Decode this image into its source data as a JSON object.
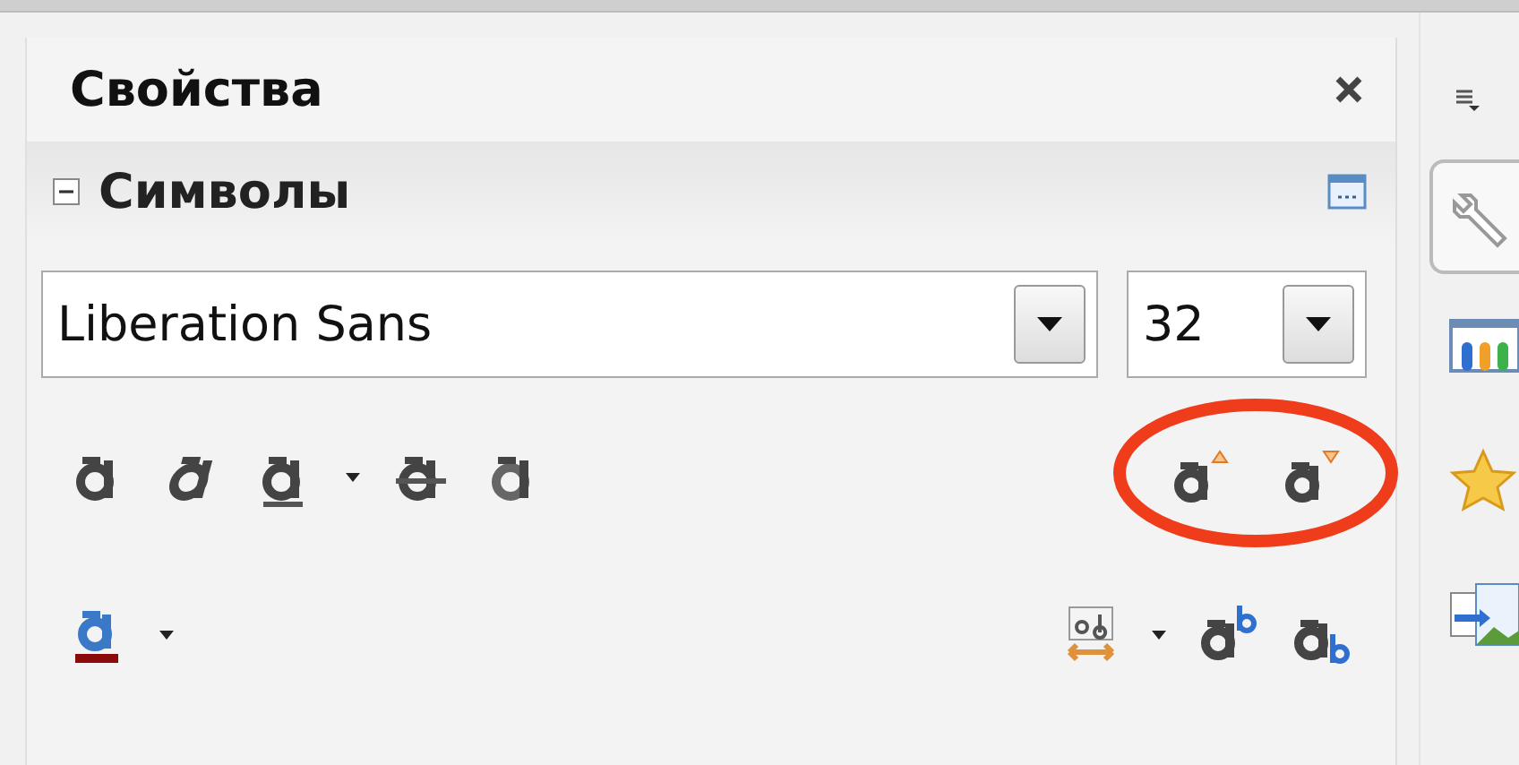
{
  "panel": {
    "title": "Свойства"
  },
  "section": {
    "title": "Символы",
    "expanded": true
  },
  "font_name": {
    "value": "Liberation Sans"
  },
  "font_size": {
    "value": "32"
  },
  "format_row": [
    {
      "kind": "bold",
      "dropdown": false
    },
    {
      "kind": "italic",
      "dropdown": false
    },
    {
      "kind": "underline",
      "dropdown": true
    },
    {
      "kind": "strike",
      "dropdown": false
    },
    {
      "kind": "shadow",
      "dropdown": false
    }
  ],
  "size_row": [
    {
      "kind": "grow",
      "dropdown": false
    },
    {
      "kind": "shrink",
      "dropdown": false
    }
  ],
  "color_row": [
    {
      "kind": "color",
      "dropdown": true
    }
  ],
  "script_row": [
    {
      "kind": "spacing",
      "dropdown": true
    },
    {
      "kind": "superscript",
      "dropdown": false
    },
    {
      "kind": "subscript",
      "dropdown": false
    }
  ],
  "deck_tabs": [
    {
      "kind": "properties",
      "selected": true
    },
    {
      "kind": "styles",
      "selected": false
    },
    {
      "kind": "gallery",
      "selected": false
    },
    {
      "kind": "navigator",
      "selected": false
    }
  ]
}
